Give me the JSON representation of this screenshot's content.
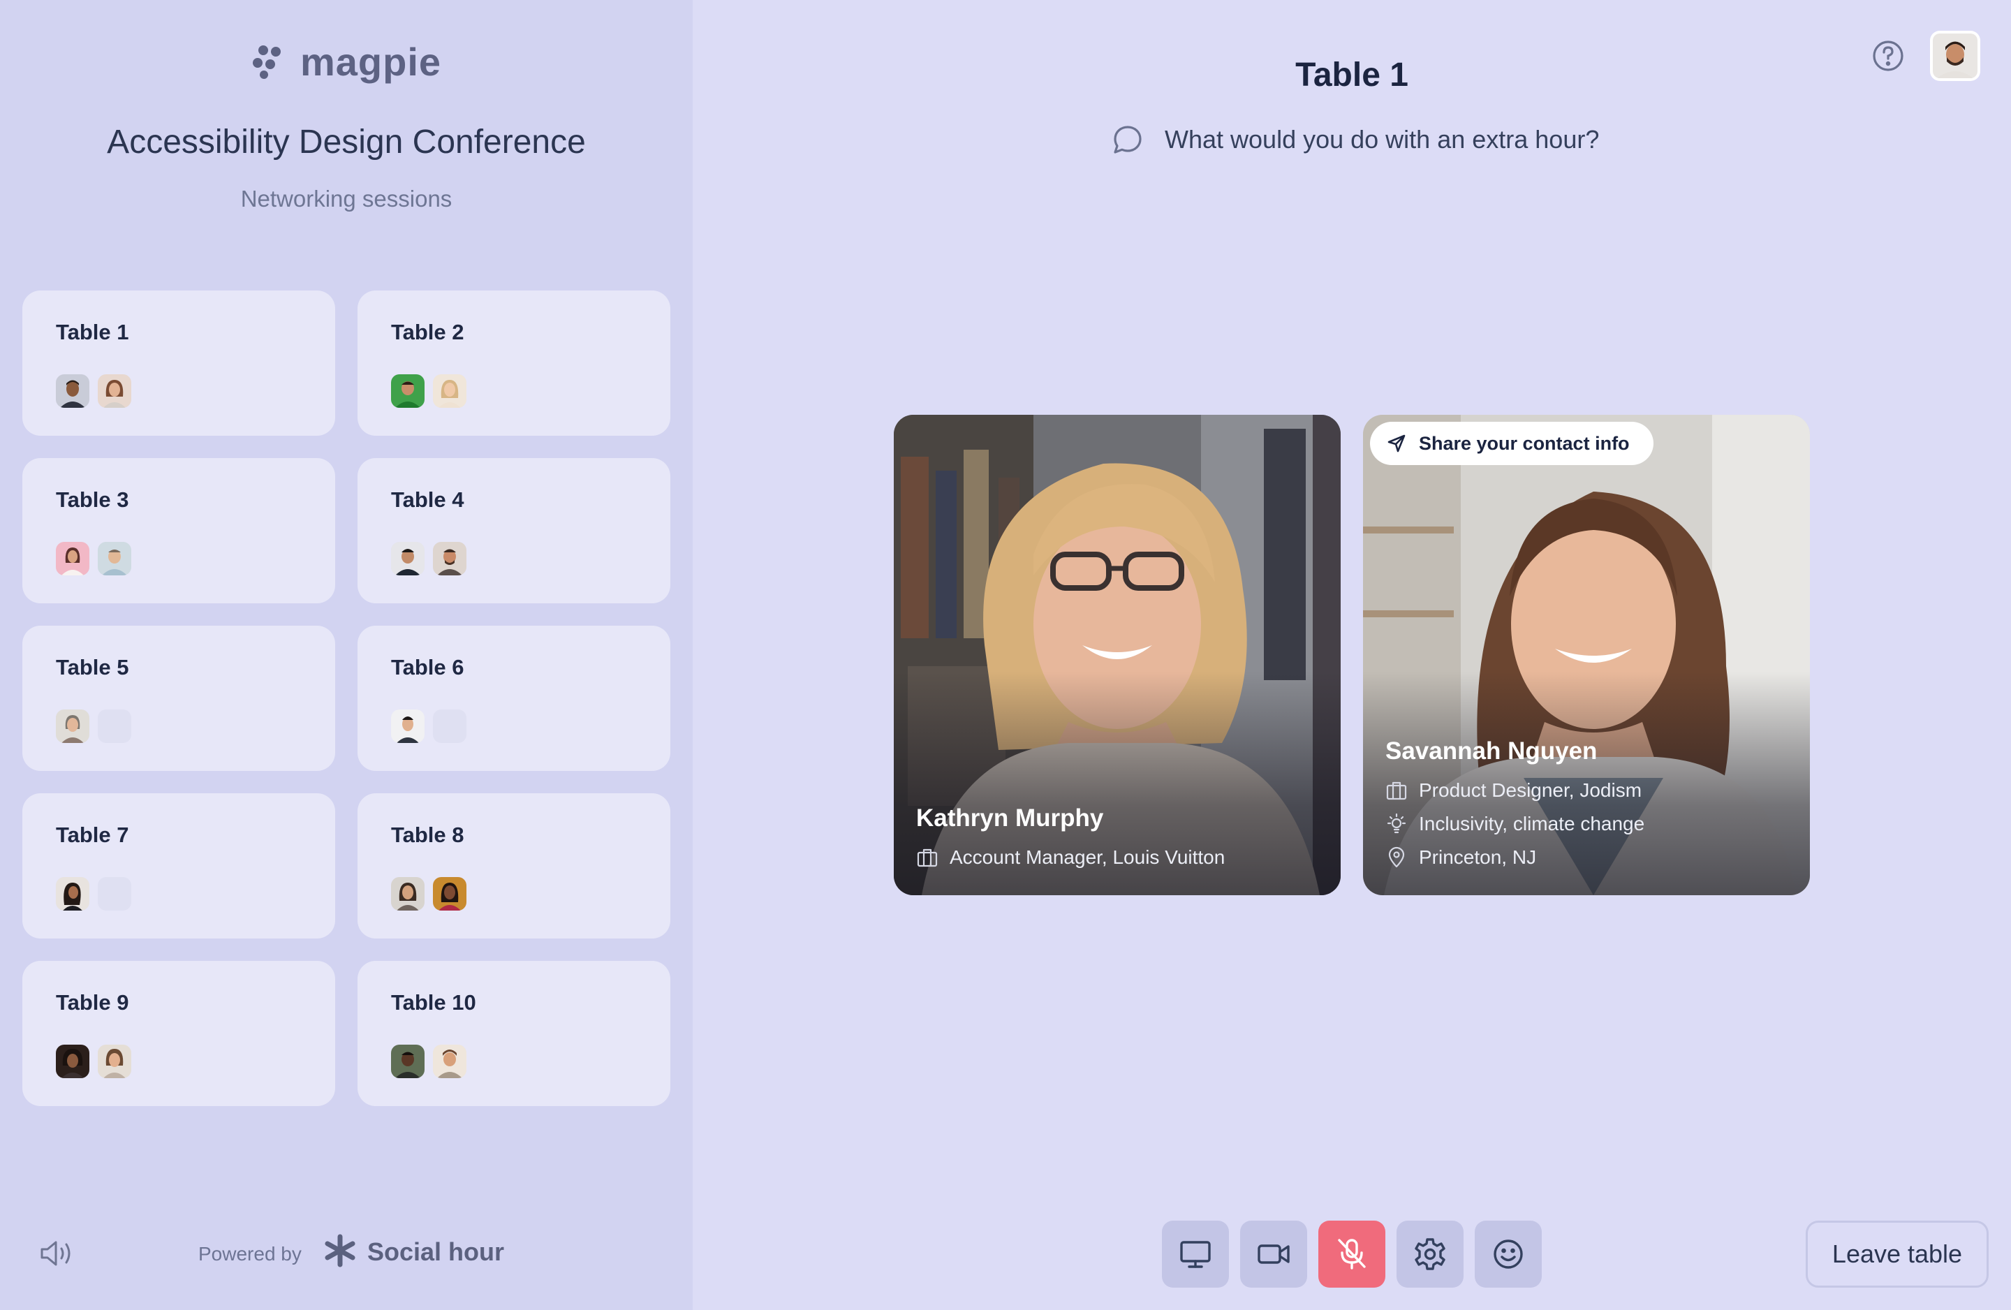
{
  "sidebar": {
    "logo_text": "magpie",
    "event_title": "Accessibility Design Conference",
    "event_subtitle": "Networking sessions",
    "tables": [
      {
        "name": "Table 1"
      },
      {
        "name": "Table 2"
      },
      {
        "name": "Table 3"
      },
      {
        "name": "Table 4"
      },
      {
        "name": "Table 5"
      },
      {
        "name": "Table 6"
      },
      {
        "name": "Table 7"
      },
      {
        "name": "Table 8"
      },
      {
        "name": "Table 9"
      },
      {
        "name": "Table 10"
      }
    ],
    "footer": {
      "powered_by": "Powered by",
      "brand": "Social hour"
    }
  },
  "main": {
    "title": "Table 1",
    "prompt": "What would you do with an extra hour?",
    "participants": [
      {
        "name": "Kathryn Murphy",
        "job": "Account Manager, Louis Vuitton"
      },
      {
        "name": "Savannah Nguyen",
        "job": "Product Designer, Jodism",
        "interests": "Inclusivity, climate change",
        "location": "Princeton, NJ",
        "share_label": "Share your contact info"
      }
    ]
  },
  "controls": {
    "leave_label": "Leave table"
  },
  "colors": {
    "sidebar_bg": "#d2d3f1",
    "main_bg": "#dcdcf6",
    "card_bg": "#e7e7f8",
    "control_bg": "#c3c5e6",
    "mute_active": "#f06b7c",
    "text_dark": "#1b2440"
  }
}
